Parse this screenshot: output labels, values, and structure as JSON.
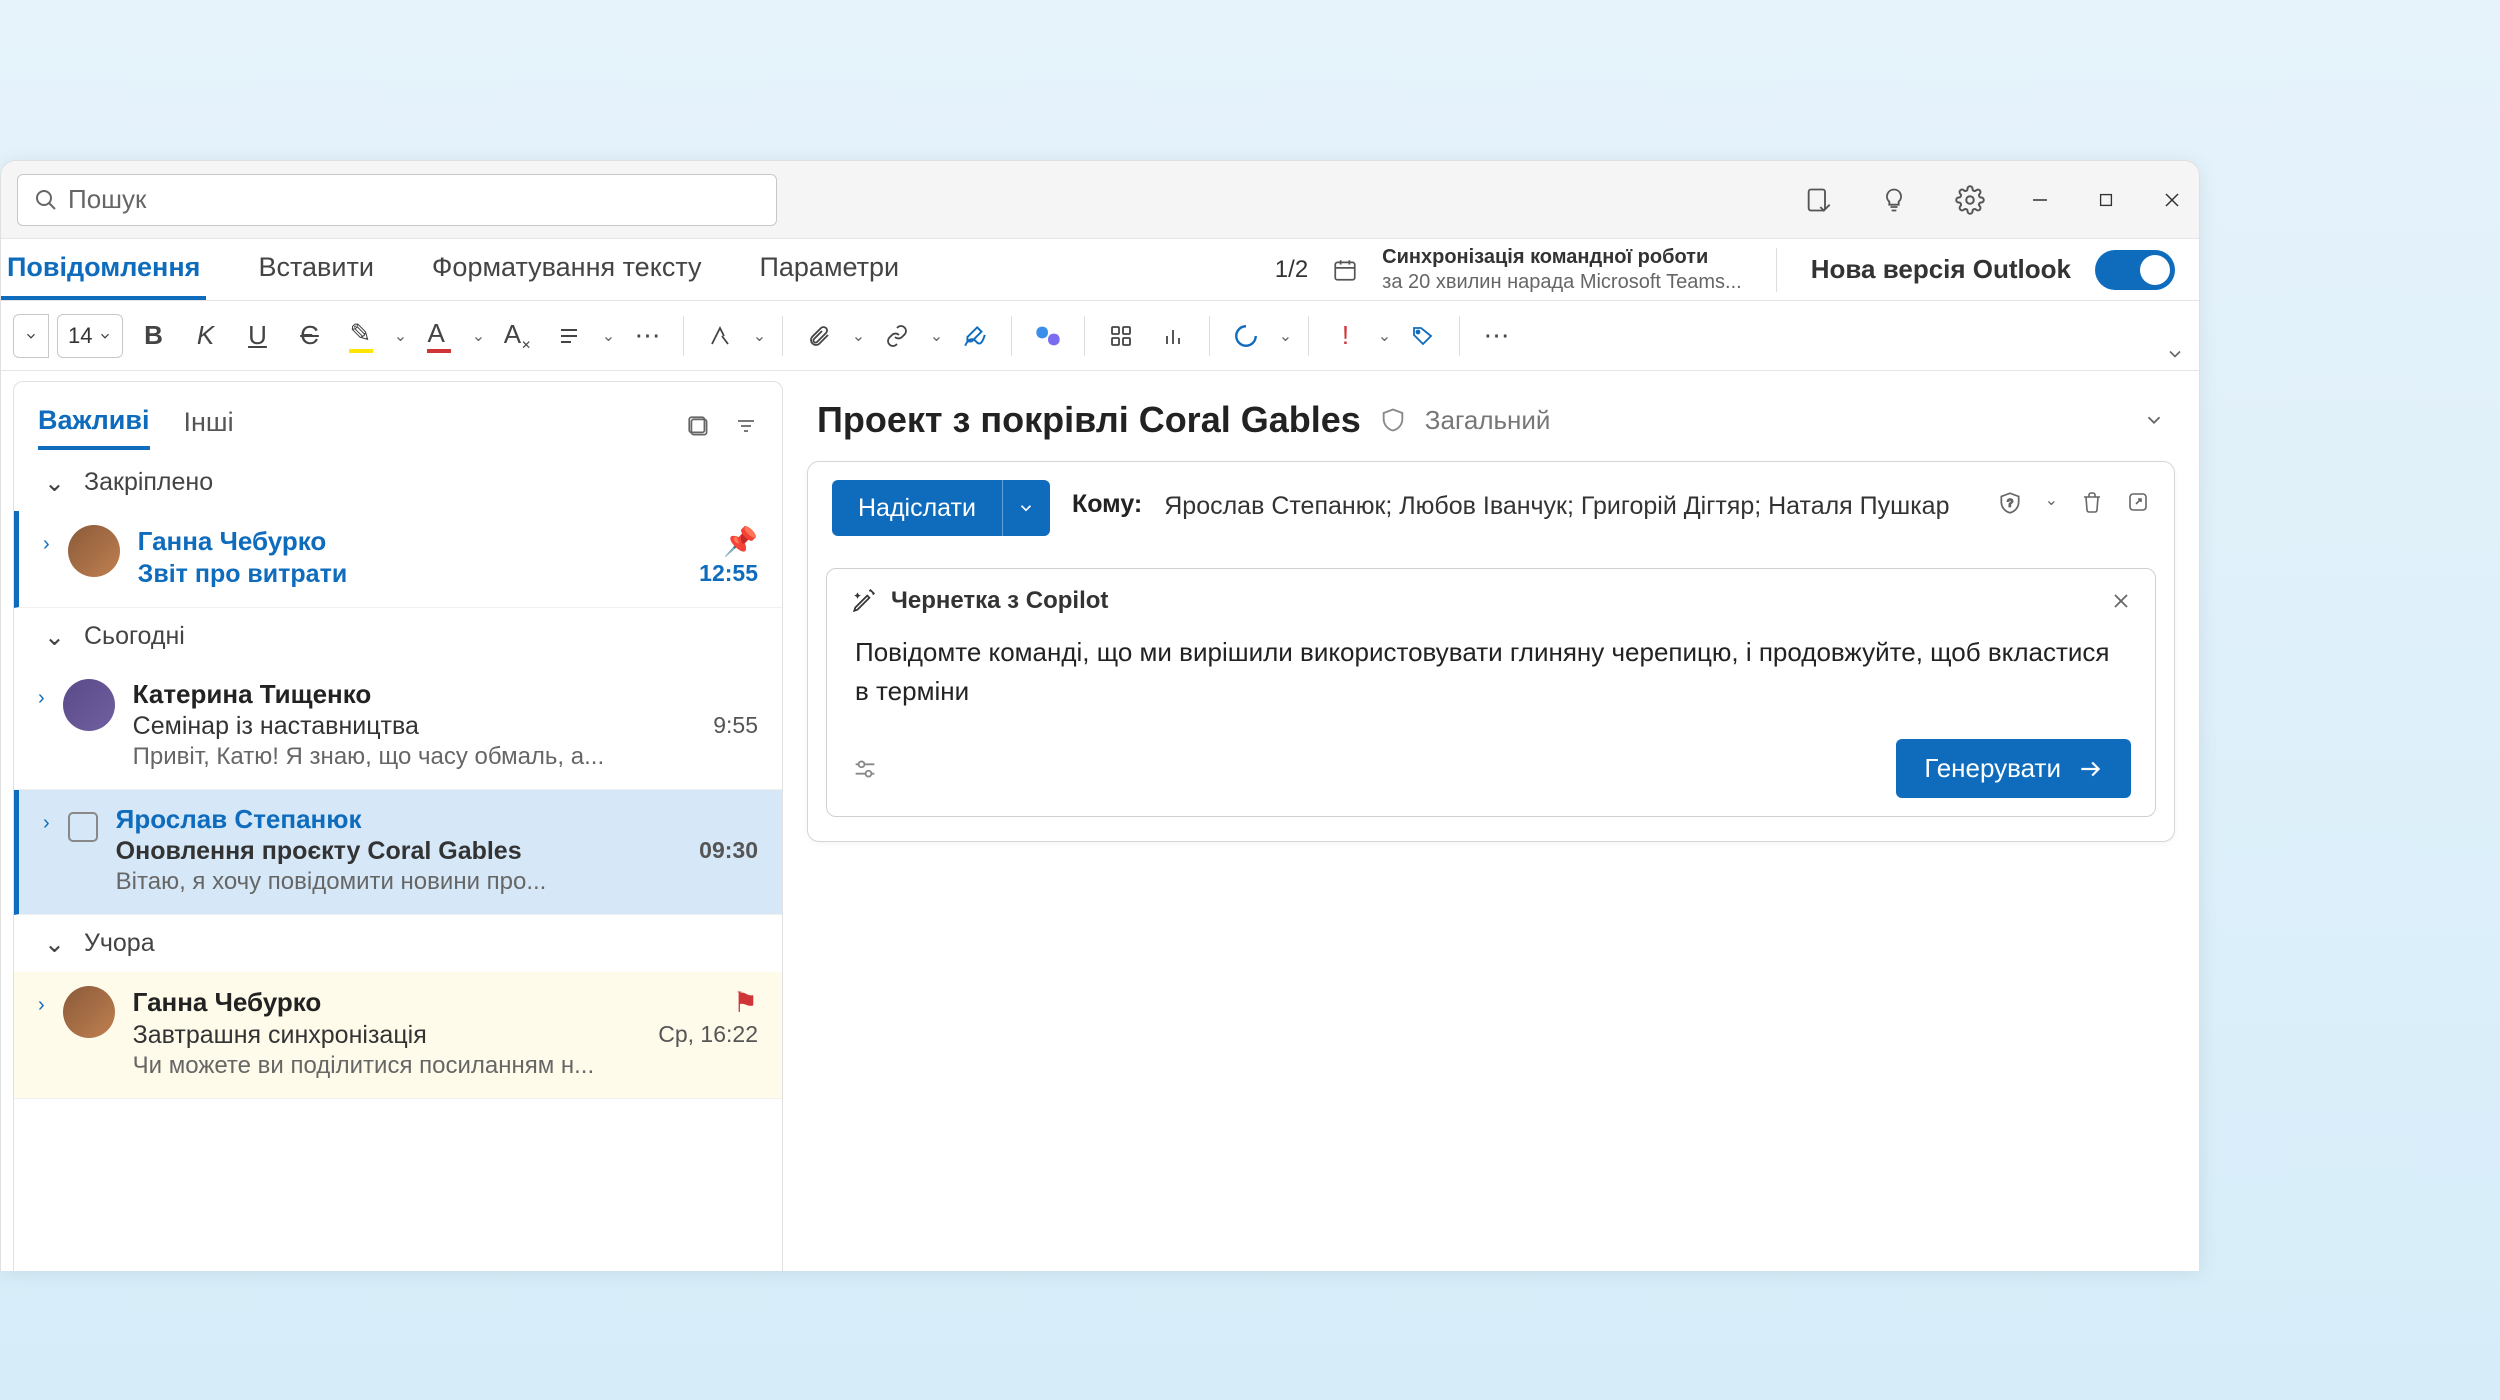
{
  "search": {
    "placeholder": "Пошук"
  },
  "tabs": {
    "message": "Повідомлення",
    "insert": "Вставити",
    "format": "Форматування тексту",
    "options": "Параметри"
  },
  "pager": "1/2",
  "sync": {
    "l1": "Синхронізація командної роботи",
    "l2": "за 20 хвилин нарада Microsoft Teams..."
  },
  "new_outlook": "Нова версія Outlook",
  "font_size": "14",
  "list_tabs": {
    "focused": "Важливі",
    "other": "Інші"
  },
  "sections": {
    "pinned": "Закріплено",
    "today": "Сьогодні",
    "yesterday": "Учора"
  },
  "messages": {
    "m1": {
      "sender": "Ганна Чебурко",
      "subject": "Звіт про витрати",
      "time": "12:55"
    },
    "m2": {
      "sender": "Катерина Тищенко",
      "subject": "Семінар із наставництва",
      "time": "9:55",
      "preview": "Привіт, Катю! Я знаю, що часу обмаль, а..."
    },
    "m3": {
      "sender": "Ярослав Степанюк",
      "subject": "Оновлення проєкту Coral Gables",
      "time": "09:30",
      "preview": "Вітаю, я хочу повідомити новини про..."
    },
    "m4": {
      "sender": "Ганна Чебурко",
      "subject": "Завтрашня синхронізація",
      "time": "Ср, 16:22",
      "preview": "Чи можете ви поділитися посиланням н..."
    }
  },
  "reading": {
    "title": "Проект з покрівлі Coral Gables",
    "tag": "Загальний"
  },
  "compose": {
    "send": "Надіслати",
    "to_label": "Кому:",
    "to": "Ярослав Степанюк; Любов Іванчук; Григорій Дігтяр; Наталя Пушкар"
  },
  "copilot": {
    "title": "Чернетка з Copilot",
    "text": "Повідомте команді, що ми вирішили використовувати глиняну черепицю, і продовжуйте, щоб вкластися в терміни",
    "generate": "Генерувати"
  }
}
